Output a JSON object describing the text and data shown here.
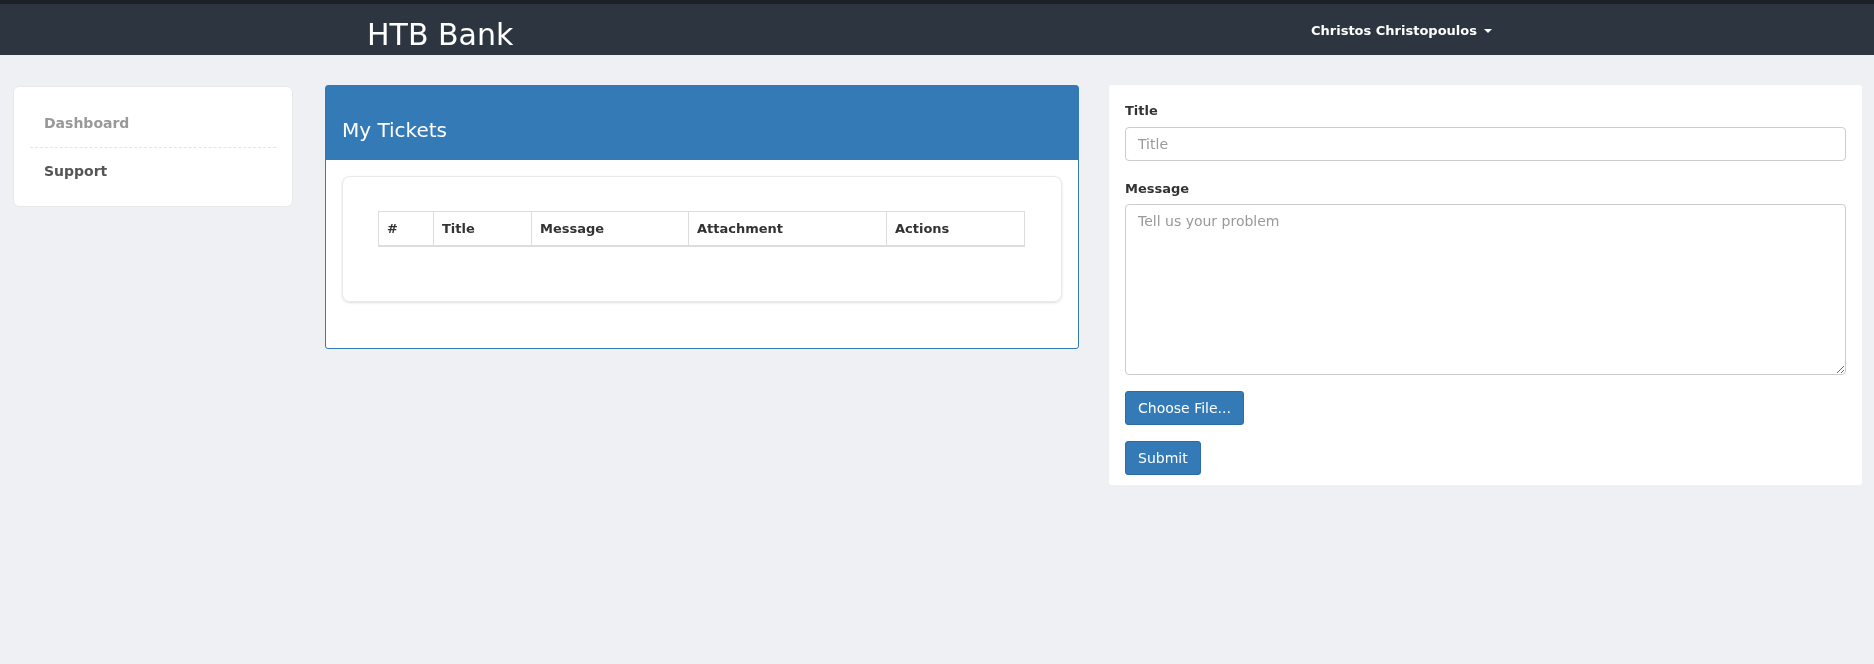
{
  "navbar": {
    "brand": "HTB Bank",
    "user_menu": "Christos Christopoulos"
  },
  "sidebar": {
    "items": [
      {
        "label": "Dashboard",
        "selected": false
      },
      {
        "label": "Support",
        "selected": true
      }
    ]
  },
  "tickets_panel": {
    "title": "My Tickets",
    "table": {
      "columns": [
        "#",
        "Title",
        "Message",
        "Attachment",
        "Actions"
      ]
    }
  },
  "ticket_form": {
    "fields": [
      {
        "kind": "input",
        "label": "Title",
        "placeholder": "Title"
      },
      {
        "kind": "textarea",
        "label": "Message",
        "placeholder": "Tell us your problem"
      }
    ],
    "file_button": "Choose File...",
    "submit_button": "Submit"
  }
}
